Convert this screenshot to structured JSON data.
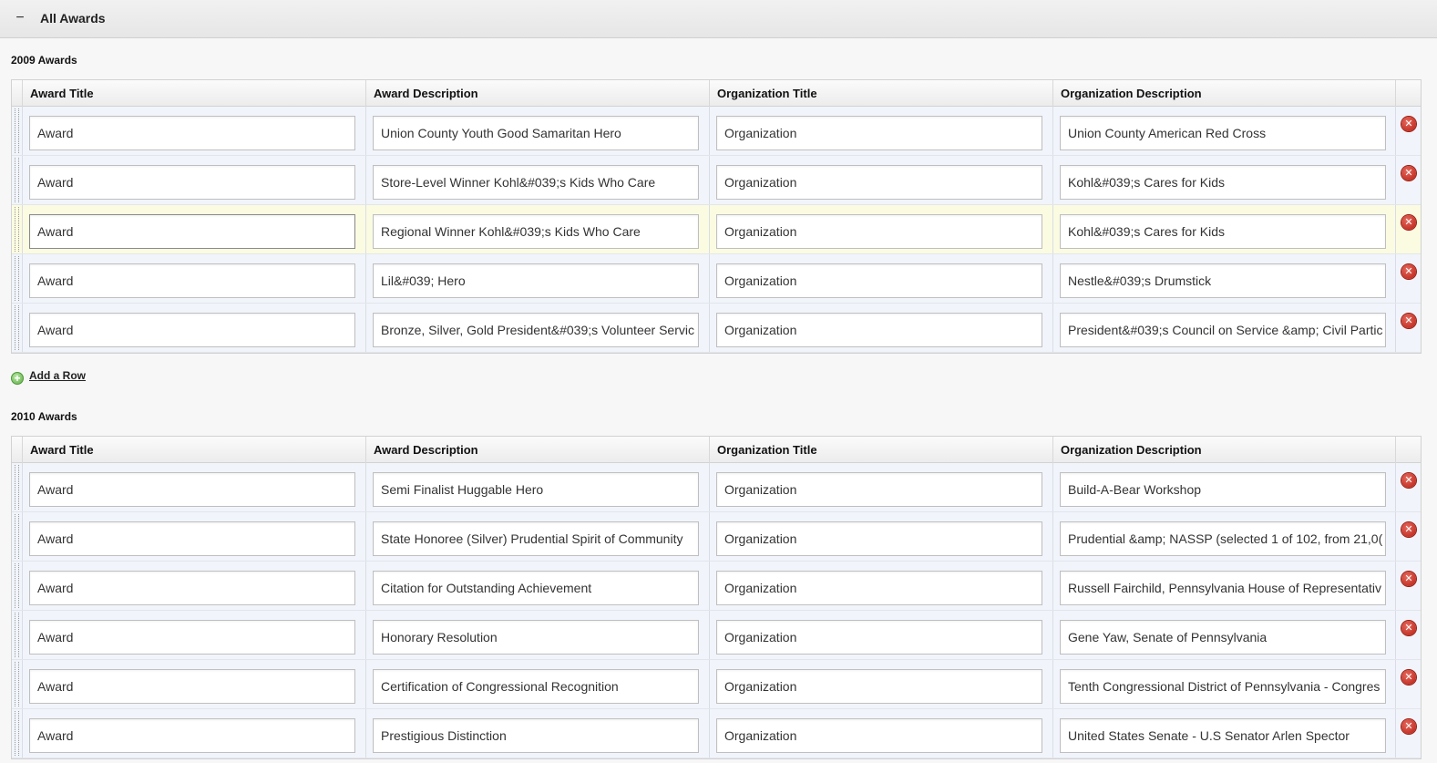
{
  "panel": {
    "title": "All Awards",
    "collapse_symbol": "−"
  },
  "columns": [
    "Award Title",
    "Award Description",
    "Organization Title",
    "Organization Description"
  ],
  "icons": {
    "delete": "close-circle-icon",
    "add": "plus-circle-icon",
    "delete_color": "#c9251a",
    "add_color": "#6bbf4e"
  },
  "delete_symbol": "✕",
  "add_symbol": "+",
  "add_row_label": "Add a Row",
  "sections": [
    {
      "title": "2009 Awards",
      "rows": [
        {
          "award_title": "Award",
          "award_description": "Union County Youth Good Samaritan Hero",
          "organization_title": "Organization",
          "organization_description": "Union County American Red Cross"
        },
        {
          "award_title": "Award",
          "award_description": "Store-Level Winner Kohl&#039;s Kids Who Care",
          "organization_title": "Organization",
          "organization_description": "Kohl&#039;s Cares for Kids"
        },
        {
          "award_title": "Award",
          "award_description": "Regional Winner Kohl&#039;s Kids Who Care",
          "organization_title": "Organization",
          "organization_description": "Kohl&#039;s Cares for Kids"
        },
        {
          "award_title": "Award",
          "award_description": "Lil&#039; Hero",
          "organization_title": "Organization",
          "organization_description": "Nestle&#039;s Drumstick"
        },
        {
          "award_title": "Award",
          "award_description": "Bronze, Silver, Gold President&#039;s Volunteer Servic",
          "organization_title": "Organization",
          "organization_description": "President&#039;s Council on Service &amp; Civil Partic"
        }
      ]
    },
    {
      "title": "2010 Awards",
      "rows": [
        {
          "award_title": "Award",
          "award_description": "Semi Finalist Huggable Hero",
          "organization_title": "Organization",
          "organization_description": "Build-A-Bear Workshop"
        },
        {
          "award_title": "Award",
          "award_description": "State Honoree (Silver) Prudential Spirit of Community",
          "organization_title": "Organization",
          "organization_description": "Prudential &amp; NASSP (selected 1 of 102, from 21,0("
        },
        {
          "award_title": "Award",
          "award_description": "Citation for Outstanding Achievement",
          "organization_title": "Organization",
          "organization_description": "Russell Fairchild, Pennsylvania House of Representativ"
        },
        {
          "award_title": "Award",
          "award_description": "Honorary Resolution",
          "organization_title": "Organization",
          "organization_description": "Gene Yaw, Senate of Pennsylvania"
        },
        {
          "award_title": "Award",
          "award_description": "Certification of Congressional Recognition",
          "organization_title": "Organization",
          "organization_description": "Tenth Congressional District of Pennsylvania - Congres"
        },
        {
          "award_title": "Award",
          "award_description": "Prestigious Distinction",
          "organization_title": "Organization",
          "organization_description": "United States Senate - U.S Senator Arlen Spector"
        }
      ]
    }
  ]
}
